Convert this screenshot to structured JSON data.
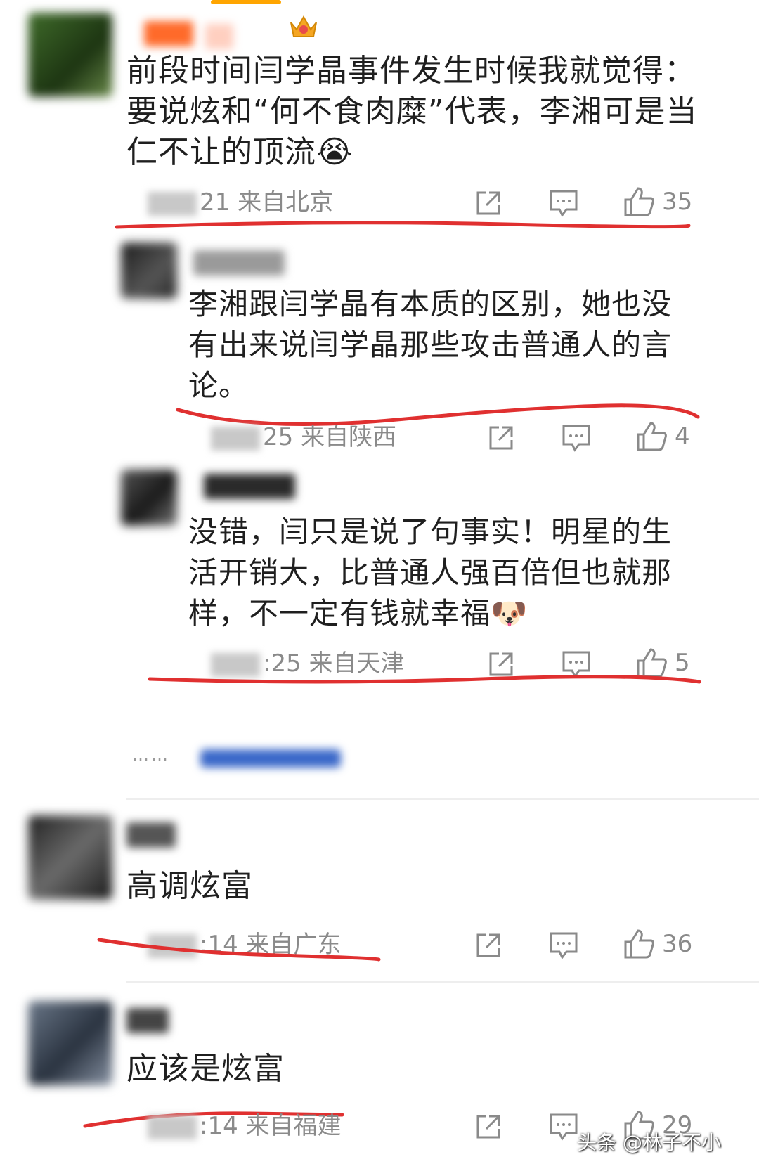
{
  "colors": {
    "annotation_red": "#e03030",
    "icon_gray": "#8a8a8a",
    "link_blue": "#3a68c9"
  },
  "comments": [
    {
      "id": "c1",
      "text": "前段时间闫学晶事件发生时候我就觉得：要说炫和“何不食肉糜”代表，李湘可是当仁不让的顶流😭",
      "time_suffix": "21",
      "location": "来自北京",
      "likes": "35",
      "badge_icon": "crown-badge-icon"
    },
    {
      "id": "r1",
      "text": "李湘跟闫学晶有本质的区别，她也没有出来说闫学晶那些攻击普通人的言论。",
      "time_suffix": "25",
      "location": "来自陕西",
      "likes": "4"
    },
    {
      "id": "r2",
      "text": "没错，闫只是说了句事实！明星的生活开销大，比普通人强百倍但也就那样，不一定有钱就幸福🐶",
      "time_suffix": ":25",
      "location": "来自天津",
      "likes": "5"
    },
    {
      "id": "c2",
      "text": "高调炫富",
      "time_suffix": ":14",
      "location": "来自广东",
      "likes": "36"
    },
    {
      "id": "c3",
      "text": "应该是炫富",
      "time_suffix": ":14",
      "location": "来自福建",
      "likes": "29"
    }
  ],
  "more_replies_dots": "……",
  "watermark": "头条 @林子不小"
}
